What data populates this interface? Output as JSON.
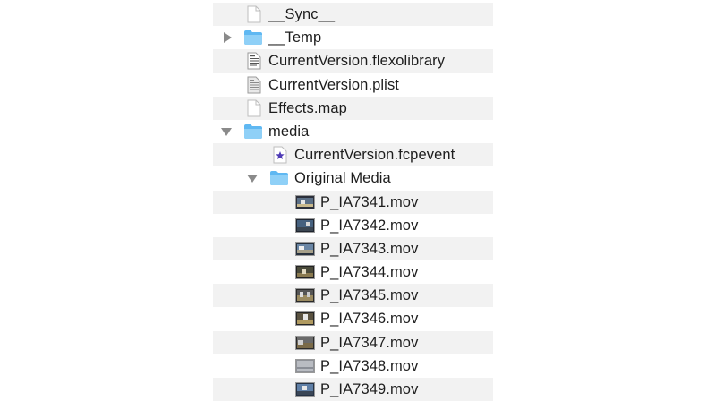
{
  "files": [
    {
      "name": "__Sync__",
      "icon": "document-icon",
      "disclosure": "none"
    },
    {
      "name": "__Temp",
      "icon": "folder-icon",
      "disclosure": "collapsed"
    },
    {
      "name": "CurrentVersion.flexolibrary",
      "icon": "library-file-icon",
      "disclosure": "none"
    },
    {
      "name": "CurrentVersion.plist",
      "icon": "plist-file-icon",
      "disclosure": "none"
    },
    {
      "name": "Effects.map",
      "icon": "document-icon",
      "disclosure": "none"
    },
    {
      "name": "media",
      "icon": "folder-icon",
      "disclosure": "expanded"
    },
    {
      "name": "CurrentVersion.fcpevent",
      "icon": "fcpevent-star-icon",
      "disclosure": "none"
    },
    {
      "name": "Original Media",
      "icon": "folder-icon",
      "disclosure": "expanded"
    },
    {
      "name": "P_IA7341.mov",
      "icon": "video-thumbnail-icon",
      "disclosure": "none"
    },
    {
      "name": "P_IA7342.mov",
      "icon": "video-thumbnail-icon",
      "disclosure": "none"
    },
    {
      "name": "P_IA7343.mov",
      "icon": "video-thumbnail-icon",
      "disclosure": "none"
    },
    {
      "name": "P_IA7344.mov",
      "icon": "video-thumbnail-icon",
      "disclosure": "none"
    },
    {
      "name": "P_IA7345.mov",
      "icon": "video-thumbnail-icon",
      "disclosure": "none"
    },
    {
      "name": "P_IA7346.mov",
      "icon": "video-thumbnail-icon",
      "disclosure": "none"
    },
    {
      "name": "P_IA7347.mov",
      "icon": "video-thumbnail-icon",
      "disclosure": "none"
    },
    {
      "name": "P_IA7348.mov",
      "icon": "video-thumbnail-icon",
      "disclosure": "none"
    },
    {
      "name": "P_IA7349.mov",
      "icon": "video-thumbnail-icon",
      "disclosure": "none"
    }
  ],
  "colors": {
    "folder": "#5fb8f2",
    "folder_tab": "#8fd0f7",
    "stripe": "#f2f2f2",
    "text": "#1d1d1d",
    "disclosure": "#8a8a8a",
    "star": "#4f3bb5"
  }
}
